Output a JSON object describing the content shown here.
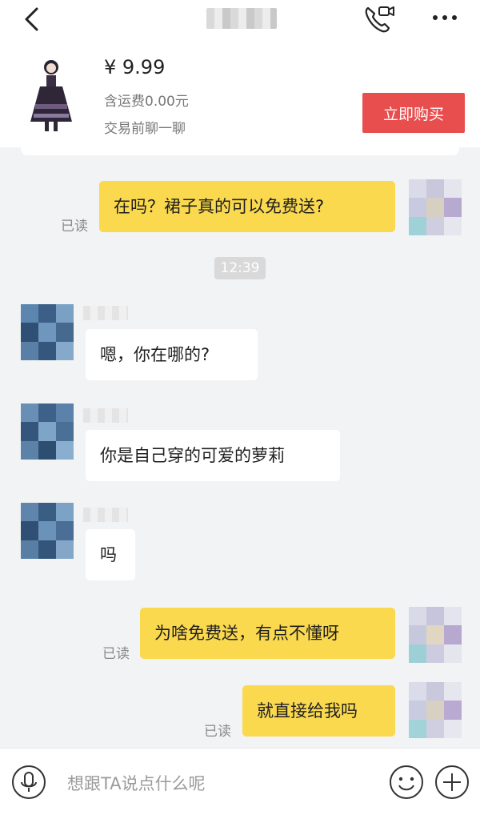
{
  "header": {
    "back_icon": "chevron-left-icon",
    "call_icon": "phone-video-icon",
    "more_icon": "more-dots-icon"
  },
  "product": {
    "price": "¥ 9.99",
    "shipping": "含运费0.00元",
    "hint": "交易前聊一聊",
    "buy_label": "立即购买",
    "buy_color": "#e84e4e"
  },
  "messages": [
    {
      "side": "me",
      "text": "在吗？裙子真的可以免费送?",
      "status": "已读"
    },
    {
      "side": "them",
      "text": "嗯，你在哪的?"
    },
    {
      "side": "them",
      "text": "你是自己穿的可爱的萝莉"
    },
    {
      "side": "them",
      "text": "吗"
    },
    {
      "side": "me",
      "text": "为啥免费送，有点不懂呀",
      "status": "已读"
    },
    {
      "side": "me",
      "text": "就直接给我吗",
      "status": "已读"
    }
  ],
  "time_divider": "12:39",
  "input": {
    "placeholder": "想跟TA说点什么呢",
    "voice_icon": "microphone-icon",
    "emoji_icon": "smiley-icon",
    "plus_icon": "plus-icon"
  },
  "colors": {
    "my_bubble": "#fad94f",
    "their_bubble": "#ffffff",
    "background": "#f2f3f5"
  }
}
